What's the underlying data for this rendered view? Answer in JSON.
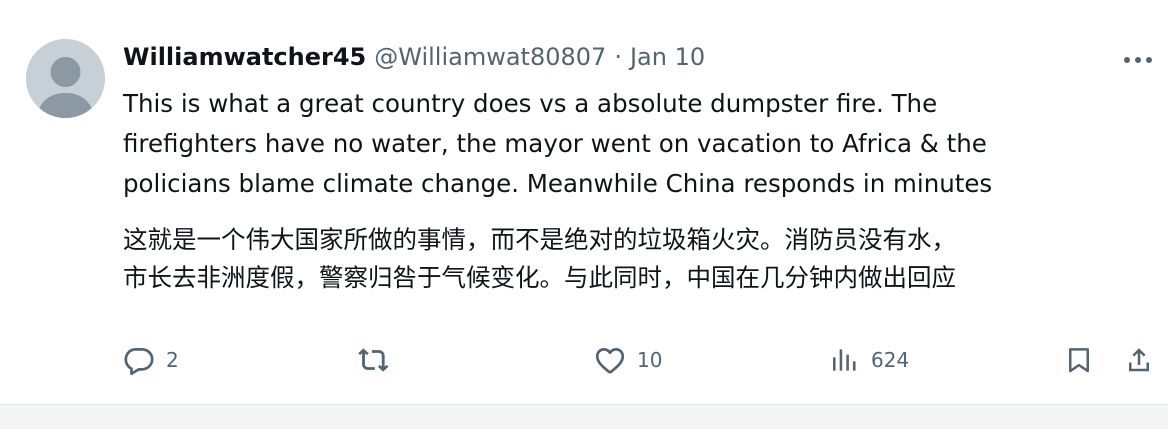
{
  "tweet": {
    "author": {
      "display_name": "Williamwatcher45",
      "handle": "@Williamwat80807",
      "separator": "·",
      "date": "Jan 10",
      "avatar_icon": "default-user-avatar-icon"
    },
    "menu_icon": "more-horizontal-icon",
    "text_en": [
      "This is what a great country does vs a absolute dumpster fire. The",
      "firefighters have no water, the mayor went on vacation to Africa & the",
      "policians blame climate change. Meanwhile China responds in minutes"
    ],
    "text_zh": [
      "这就是一个伟大国家所做的事情，而不是绝对的垃圾箱火灾。消防员没有水，",
      "市长去非洲度假，警察归咎于气候变化。与此同时，中国在几分钟内做出回应"
    ],
    "actions": {
      "reply": {
        "icon": "reply-icon",
        "count": "2"
      },
      "retweet": {
        "icon": "retweet-icon",
        "count": ""
      },
      "like": {
        "icon": "heart-icon",
        "count": "10"
      },
      "views": {
        "icon": "analytics-icon",
        "count": "624"
      },
      "bookmark": {
        "icon": "bookmark-icon"
      },
      "share": {
        "icon": "share-icon"
      }
    }
  },
  "colors": {
    "text_primary": "#0f1419",
    "text_secondary": "#536471",
    "avatar_bg": "#c8d0d7",
    "avatar_fg": "#8d98a5"
  }
}
